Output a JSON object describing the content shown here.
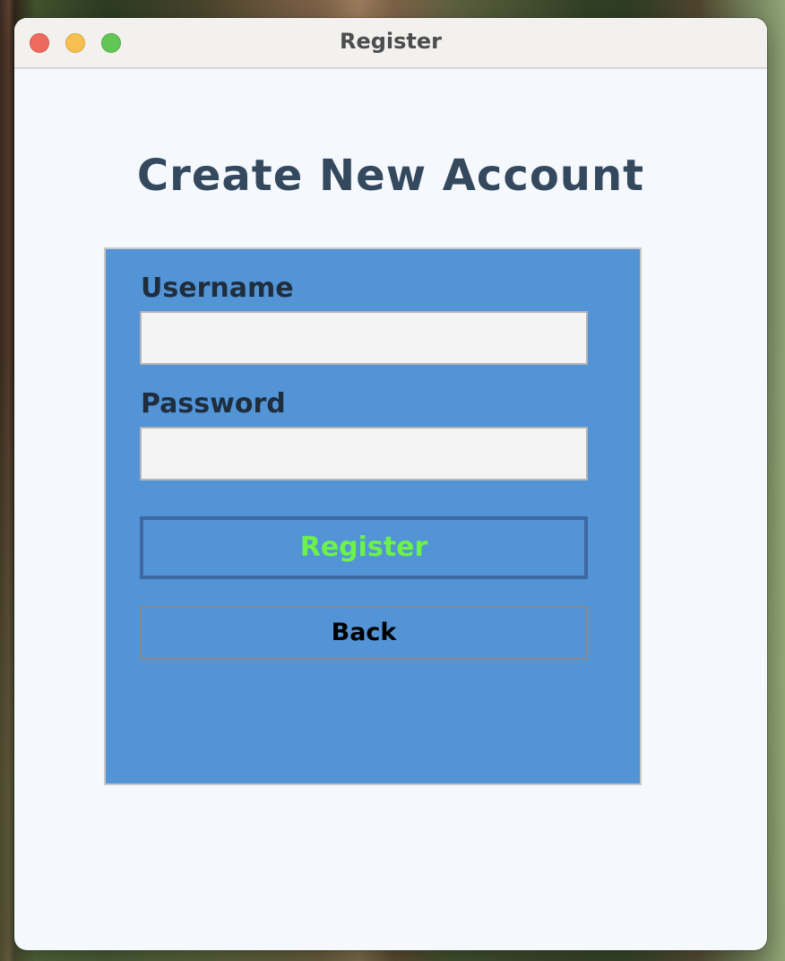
{
  "window": {
    "title": "Register"
  },
  "page": {
    "heading": "Create New Account"
  },
  "form": {
    "username_label": "Username",
    "username_value": "",
    "password_label": "Password",
    "password_value": "",
    "register_label": "Register",
    "back_label": "Back"
  },
  "colors": {
    "panel_background": "#5294d6",
    "heading_text": "#34495e",
    "register_text": "#6cf24a",
    "register_border": "#3c6aa0",
    "window_background": "#f5f8fc"
  }
}
